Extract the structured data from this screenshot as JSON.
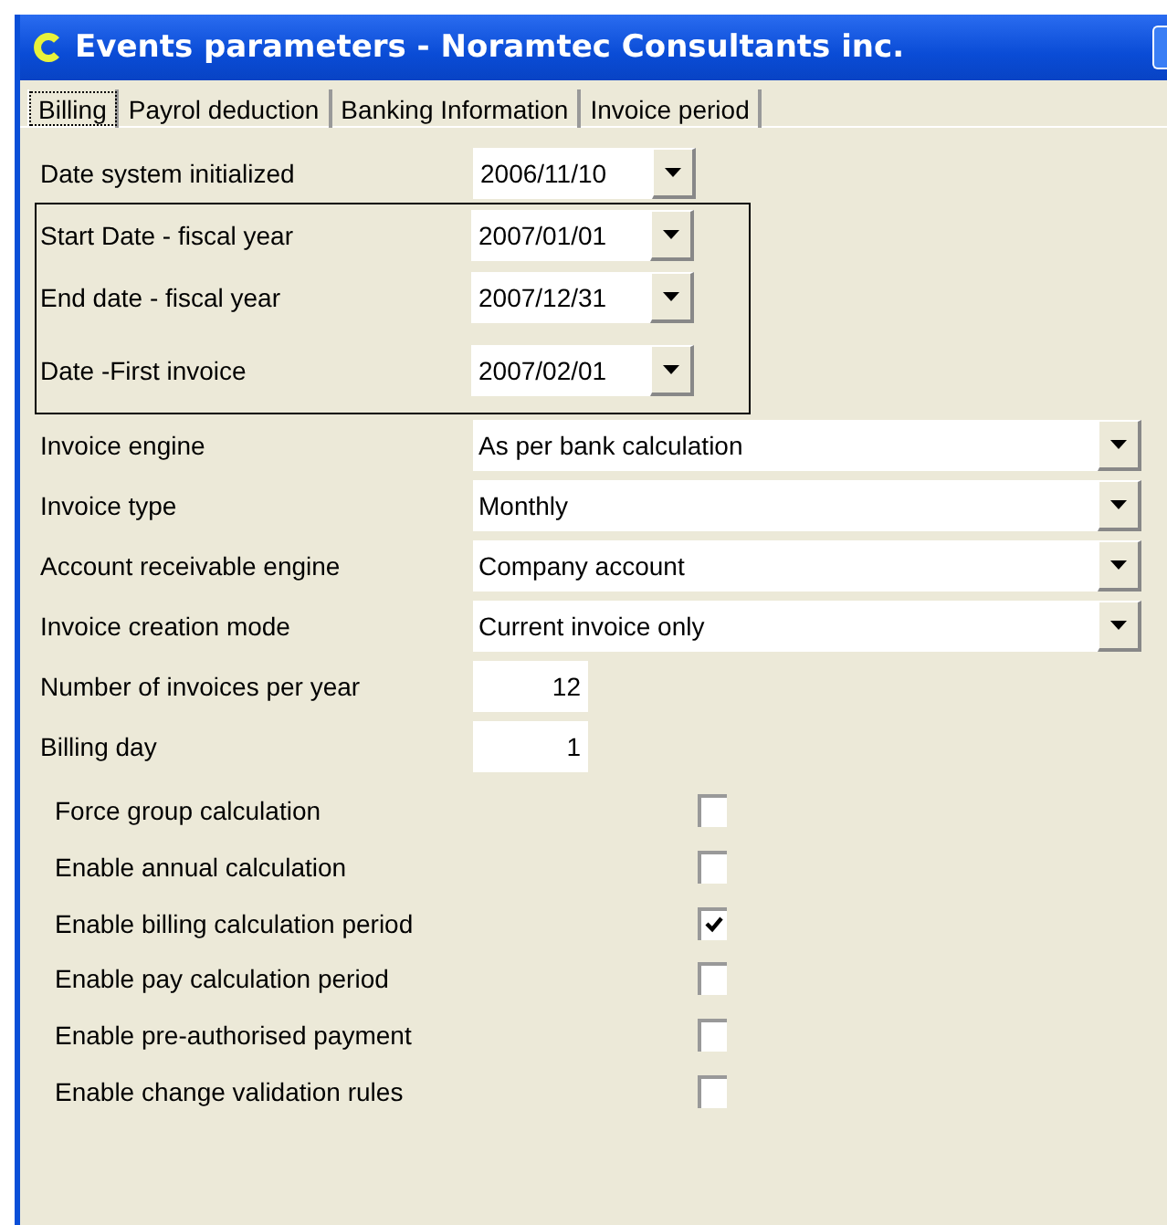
{
  "window": {
    "title": "Events parameters - Noramtec Consultants inc."
  },
  "tabs": [
    {
      "label": "Billing",
      "selected": true
    },
    {
      "label": "Payrol deduction",
      "selected": false
    },
    {
      "label": "Banking Information",
      "selected": false
    },
    {
      "label": "Invoice period",
      "selected": false
    }
  ],
  "date_fields": [
    {
      "label": "Date system initialized",
      "value": "2006/11/10"
    }
  ],
  "fiscal_group": [
    {
      "label": "Start Date - fiscal year",
      "value": "2007/01/01"
    },
    {
      "label": "End date - fiscal year",
      "value": "2007/12/31"
    },
    {
      "label": "Date -First invoice",
      "value": "2007/02/01"
    }
  ],
  "combo_fields": [
    {
      "label": "Invoice engine",
      "value": "As per bank calculation"
    },
    {
      "label": "Invoice type",
      "value": "Monthly"
    },
    {
      "label": "Account receivable engine",
      "value": "Company account"
    },
    {
      "label": "Invoice creation mode",
      "value": "Current invoice only"
    }
  ],
  "number_fields": [
    {
      "label": "Number of invoices per year",
      "value": "12"
    },
    {
      "label": "Billing day",
      "value": "1"
    }
  ],
  "options": [
    {
      "label": "Force group calculation",
      "checked": false
    },
    {
      "label": "Enable annual calculation",
      "checked": false
    },
    {
      "label": "Enable billing calculation period",
      "checked": true
    },
    {
      "label": "Enable pay calculation period",
      "checked": false
    },
    {
      "label": "Enable pre-authorised payment",
      "checked": false
    },
    {
      "label": "Enable change validation rules",
      "checked": false
    }
  ]
}
